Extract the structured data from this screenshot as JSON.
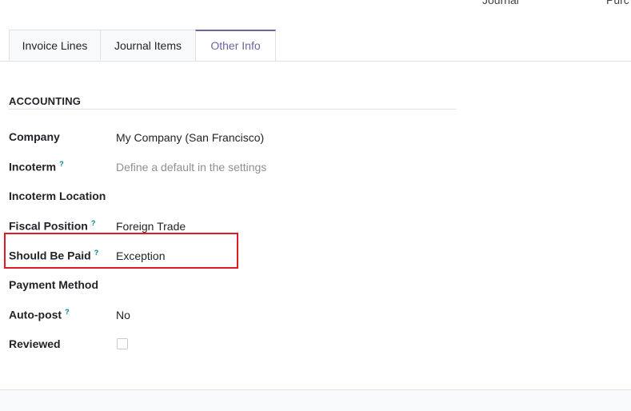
{
  "top_fields": {
    "field1_label": "Journal",
    "field2_label": "Purc"
  },
  "tabs": [
    {
      "label": "Invoice Lines",
      "active": false
    },
    {
      "label": "Journal Items",
      "active": false
    },
    {
      "label": "Other Info",
      "active": true
    }
  ],
  "section": {
    "title": "ACCOUNTING"
  },
  "fields": {
    "company": {
      "label": "Company",
      "value": "My Company (San Francisco)"
    },
    "incoterm": {
      "label": "Incoterm",
      "help": "?",
      "placeholder": "Define a default in the settings"
    },
    "incoterm_location": {
      "label": "Incoterm Location",
      "value": ""
    },
    "fiscal_position": {
      "label": "Fiscal Position",
      "help": "?",
      "value": "Foreign Trade"
    },
    "should_be_paid": {
      "label": "Should Be Paid",
      "help": "?",
      "value": "Exception"
    },
    "payment_method": {
      "label": "Payment Method",
      "value": ""
    },
    "auto_post": {
      "label": "Auto-post",
      "help": "?",
      "value": "No"
    },
    "reviewed": {
      "label": "Reviewed",
      "checked": false
    }
  },
  "colors": {
    "accent": "#71639e",
    "help": "#017e84",
    "highlight": "#e01b24"
  }
}
